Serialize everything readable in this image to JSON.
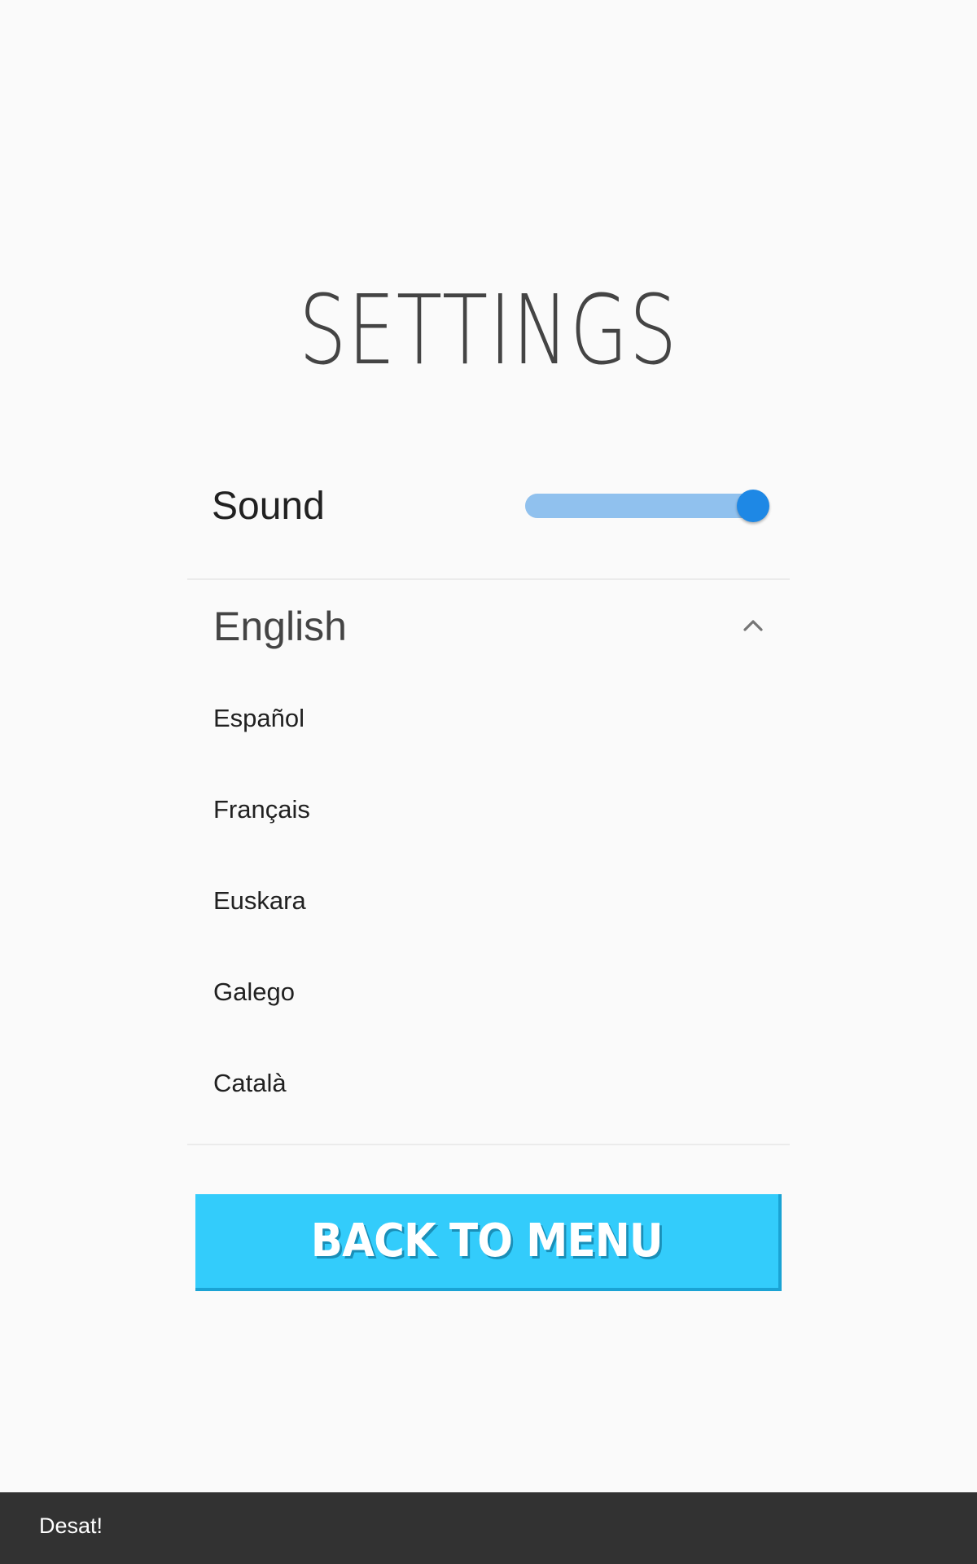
{
  "screen": {
    "title": "SETTINGS"
  },
  "sound": {
    "label": "Sound",
    "value": 1.0,
    "fill_color": "#90c1ee",
    "thumb_color": "#1e88e5"
  },
  "language": {
    "selected": "English",
    "expanded": true,
    "toggle_icon": "chevron-up-icon",
    "options": [
      "Español",
      "Français",
      "Euskara",
      "Galego",
      "Català"
    ]
  },
  "back_button": {
    "label": "BACK TO MENU",
    "color": "#33ccfb"
  },
  "snackbar": {
    "message": "Desat!"
  }
}
